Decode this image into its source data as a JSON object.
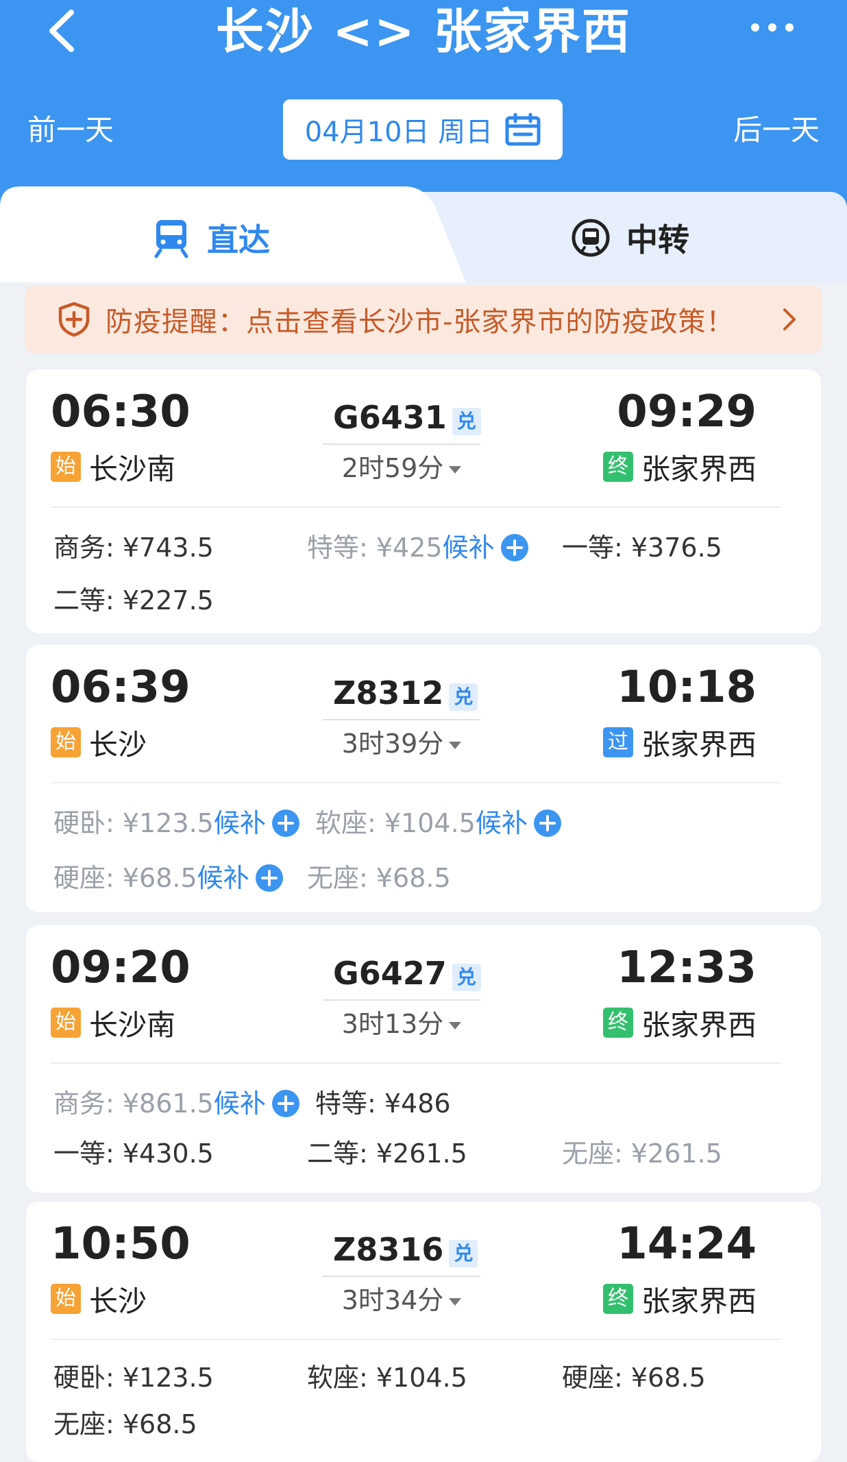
{
  "header": {
    "title": "长沙 <> 张家界西",
    "prev_day": "前一天",
    "next_day": "后一天",
    "date": "04月10日 周日",
    "accent": "#3b95f1"
  },
  "tabs": [
    {
      "label": "直达",
      "icon": "train-icon",
      "active": true
    },
    {
      "label": "中转",
      "icon": "transfer-icon",
      "active": false
    }
  ],
  "notice": {
    "text": "防疫提醒：点击查看长沙市-张家界市的防疫政策！",
    "icon": "shield-icon"
  },
  "trains": [
    {
      "dep_time": "06:30",
      "dep_tag": "始",
      "dep_station": "长沙南",
      "train_no": "G6431",
      "badge": "兑",
      "duration": "2时59分",
      "arr_time": "09:29",
      "arr_tag": "终",
      "arr_station": "张家界西",
      "seats": [
        {
          "label": "商务: ¥743.5",
          "wait": "",
          "grey": false
        },
        {
          "label": "特等: ¥425",
          "wait": "候补",
          "grey": true
        },
        {
          "label": "一等: ¥376.5",
          "wait": "",
          "grey": false
        },
        {
          "label": "二等: ¥227.5",
          "wait": "",
          "grey": false
        }
      ]
    },
    {
      "dep_time": "06:39",
      "dep_tag": "始",
      "dep_station": "长沙",
      "train_no": "Z8312",
      "badge": "兑",
      "duration": "3时39分",
      "arr_time": "10:18",
      "arr_tag": "过",
      "arr_station": "张家界西",
      "seats": [
        {
          "label": "硬卧: ¥123.5",
          "wait": "候补",
          "grey": true
        },
        {
          "label": "软座: ¥104.5",
          "wait": "候补",
          "grey": true
        },
        {
          "label": "硬座: ¥68.5",
          "wait": "候补",
          "grey": true
        },
        {
          "label": "无座: ¥68.5",
          "wait": "",
          "grey": true
        }
      ]
    },
    {
      "dep_time": "09:20",
      "dep_tag": "始",
      "dep_station": "长沙南",
      "train_no": "G6427",
      "badge": "兑",
      "duration": "3时13分",
      "arr_time": "12:33",
      "arr_tag": "终",
      "arr_station": "张家界西",
      "seats": [
        {
          "label": "商务: ¥861.5",
          "wait": "候补",
          "grey": true
        },
        {
          "label": "特等: ¥486",
          "wait": "",
          "grey": false
        },
        {
          "label": "一等: ¥430.5",
          "wait": "",
          "grey": false
        },
        {
          "label": "二等: ¥261.5",
          "wait": "",
          "grey": false
        },
        {
          "label": "无座: ¥261.5",
          "wait": "",
          "grey": true
        }
      ]
    },
    {
      "dep_time": "10:50",
      "dep_tag": "始",
      "dep_station": "长沙",
      "train_no": "Z8316",
      "badge": "兑",
      "duration": "3时34分",
      "arr_time": "14:24",
      "arr_tag": "终",
      "arr_station": "张家界西",
      "seats": [
        {
          "label": "硬卧: ¥123.5",
          "wait": "",
          "grey": false
        },
        {
          "label": "软座: ¥104.5",
          "wait": "",
          "grey": false
        },
        {
          "label": "硬座: ¥68.5",
          "wait": "",
          "grey": false
        },
        {
          "label": "无座: ¥68.5",
          "wait": "",
          "grey": false
        }
      ]
    }
  ]
}
